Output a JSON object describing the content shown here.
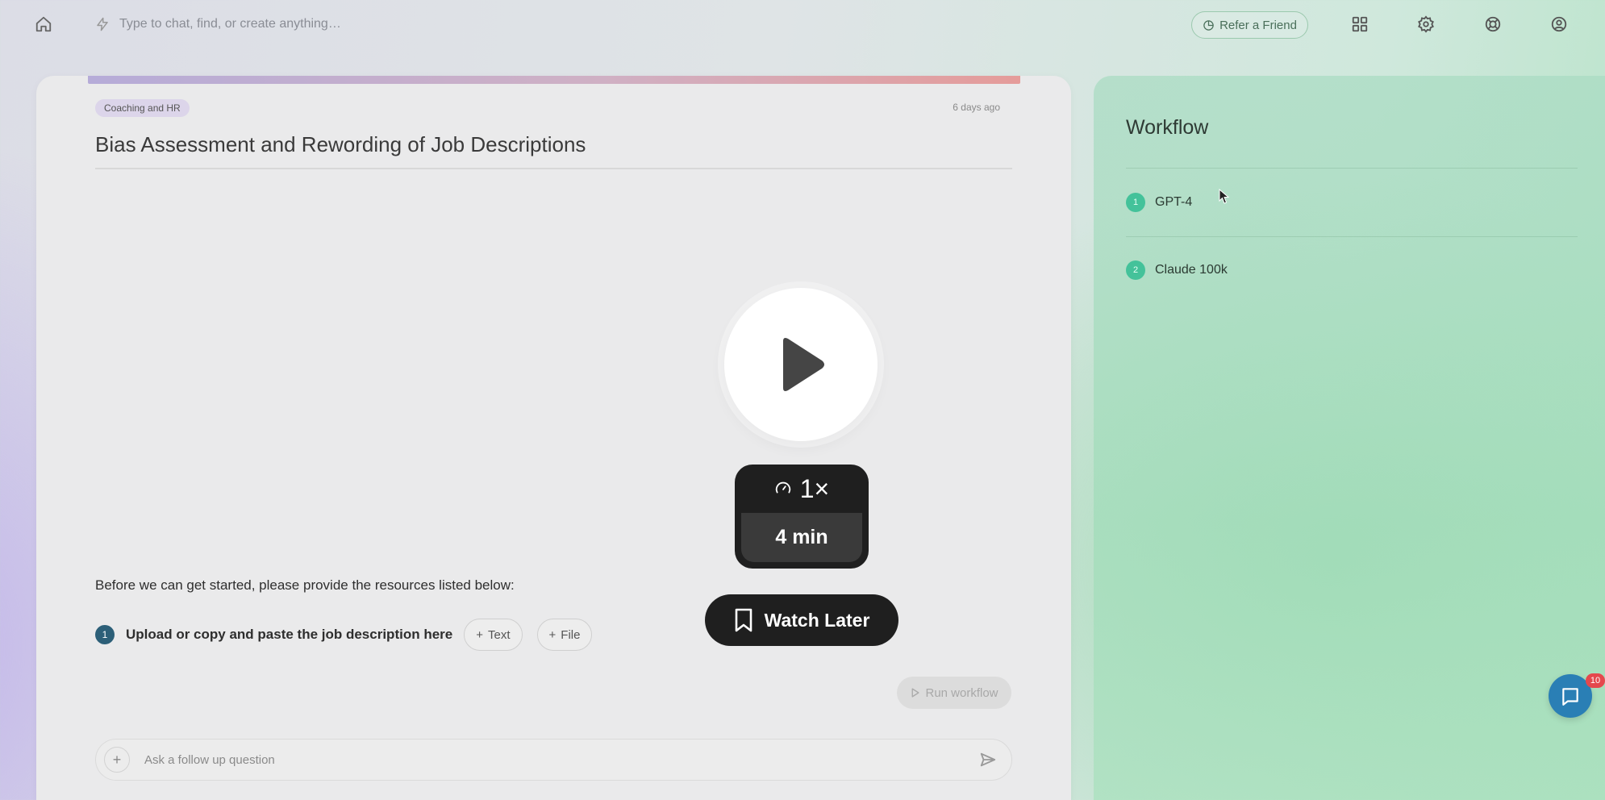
{
  "topbar": {
    "command_placeholder": "Type to chat, find, or create anything…",
    "refer_label": "Refer a Friend",
    "icons": [
      "home-icon",
      "bolt-icon",
      "refer-icon",
      "grid-icon",
      "settings-icon",
      "help-icon",
      "account-icon"
    ]
  },
  "main": {
    "category": "Coaching and HR",
    "timestamp": "6 days ago",
    "title": "Bias Assessment and Rewording of Job Descriptions",
    "prompt": "Before we can get started, please provide the resources listed below:",
    "resources": [
      {
        "number": "1",
        "label": "Upload or copy and paste the job description here",
        "text_button": "Text",
        "file_button": "File"
      }
    ],
    "run_label": "Run workflow",
    "followup_placeholder": "Ask a follow up question"
  },
  "workflow": {
    "title": "Workflow",
    "steps": [
      {
        "number": "1",
        "label": "GPT-4"
      },
      {
        "number": "2",
        "label": "Claude 100k"
      }
    ]
  },
  "video": {
    "speed": "1×",
    "duration": "4 min",
    "watch_later_label": "Watch Later"
  },
  "chat": {
    "badge_count": "10"
  },
  "colors": {
    "accent_gradient_start": "#b6acd8",
    "accent_gradient_end": "#e59c9a",
    "step_badge": "#2c5f78",
    "workflow_badge": "#44c29a",
    "chat_button": "#2a7fb5"
  }
}
